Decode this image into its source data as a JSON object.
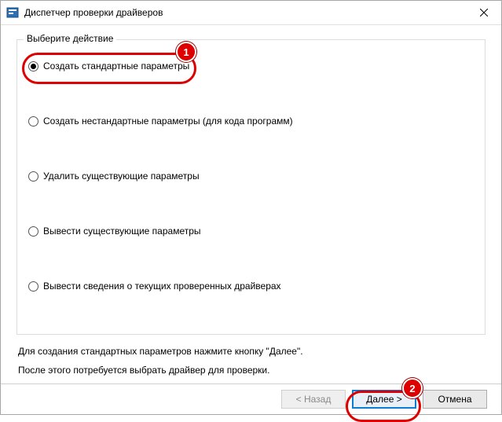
{
  "window": {
    "title": "Диспетчер проверки драйверов"
  },
  "group": {
    "label": "Выберите действие",
    "options": [
      {
        "label": "Создать стандартные параметры",
        "checked": true
      },
      {
        "label": "Создать нестандартные параметры (для кода программ)",
        "checked": false
      },
      {
        "label": "Удалить существующие параметры",
        "checked": false
      },
      {
        "label": "Вывести существующие параметры",
        "checked": false
      },
      {
        "label": "Вывести сведения о текущих проверенных драйверах",
        "checked": false
      }
    ]
  },
  "hint": {
    "line1": "Для создания стандартных параметров нажмите кнопку \"Далее\".",
    "line2": "После этого потребуется выбрать драйвер для проверки."
  },
  "footer": {
    "back": "< Назад",
    "next": "Далее >",
    "cancel": "Отмена"
  },
  "callouts": {
    "one": "1",
    "two": "2"
  }
}
